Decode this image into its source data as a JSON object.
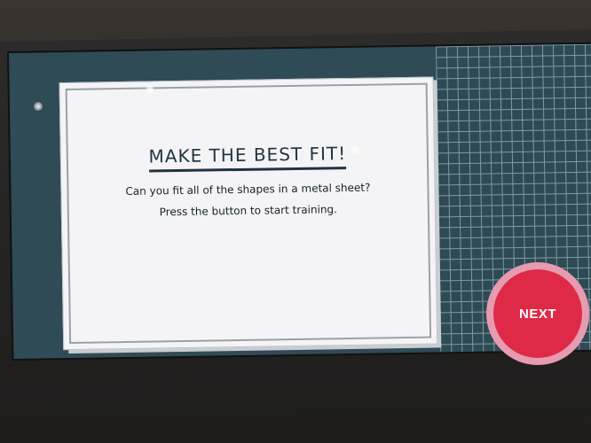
{
  "screen": {
    "title": "MAKE THE BEST FIT!",
    "line1": "Can you fit all of the shapes in a metal sheet?",
    "line2": "Press the button to start training."
  },
  "next_button": {
    "label": "NEXT"
  },
  "colors": {
    "screen_bg": "#2f4b55",
    "grid_line": "#7f9aa2",
    "card_bg": "#f4f4f6",
    "title_text": "#1f3340",
    "button_ring": "#e79bb1",
    "button_core": "#df2a47"
  }
}
